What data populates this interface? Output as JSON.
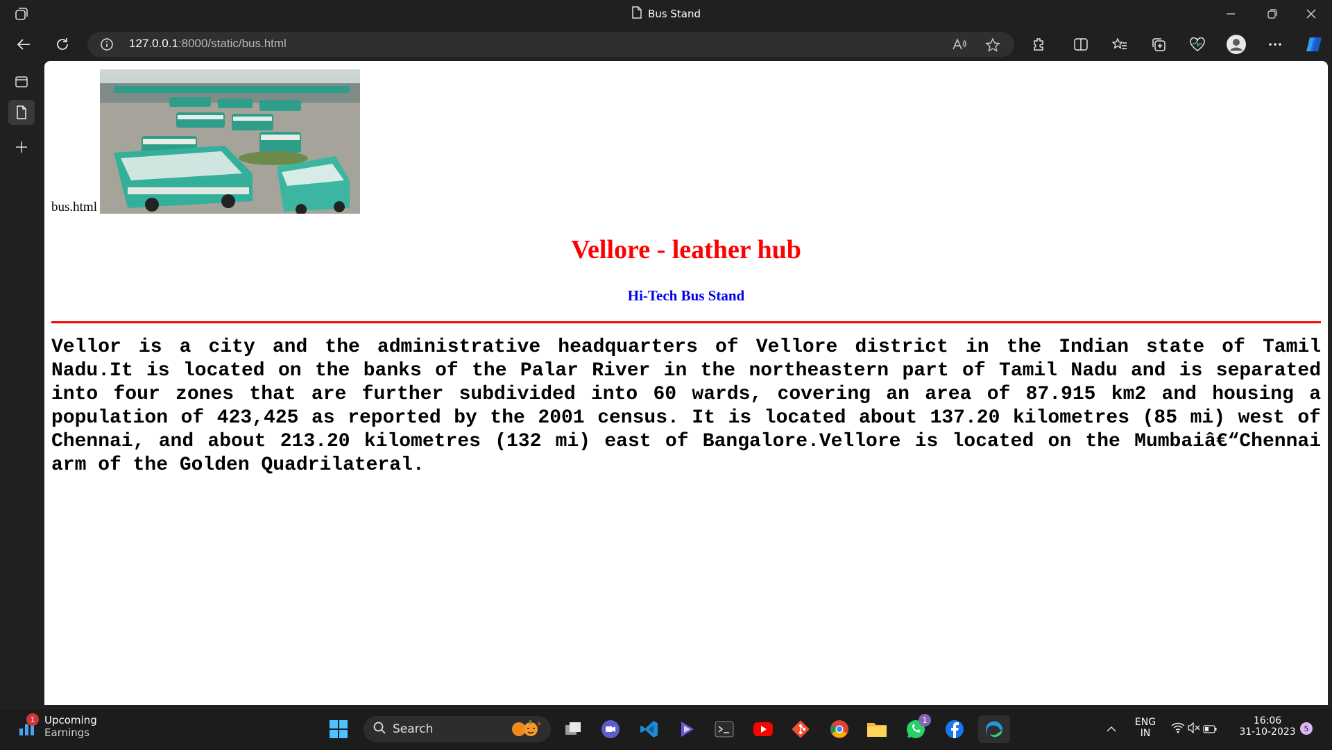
{
  "window": {
    "tab_title": "Bus Stand"
  },
  "address_bar": {
    "url_host": "127.0.0.1",
    "url_path": ":8000/static/bus.html"
  },
  "page": {
    "image_alt": "bus.html",
    "heading": "Vellore - leather hub",
    "subheading": "Hi-Tech Bus Stand",
    "paragraph": "Vellor is a city and the administrative headquarters of Vellore district in the Indian state of Tamil Nadu.It is located on the banks of the Palar River in the northeastern part of Tamil Nadu and is separated into four zones that are further subdivided into 60 wards, covering an area of 87.915 km2 and housing a population of 423,425 as reported by the 2001 census. It is located about 137.20 kilometres (85 mi) west of Chennai, and about 213.20 kilometres (132 mi) east of Bangalore.Vellore is located on the Mumbaiâ€“Chennai arm of the Golden Quadrilateral."
  },
  "taskbar": {
    "widget_title": "Upcoming",
    "widget_subtitle": "Earnings",
    "widget_badge": "1",
    "search_label": "Search",
    "whatsapp_badge": "1",
    "lang_top": "ENG",
    "lang_bottom": "IN",
    "time": "16:06",
    "date": "31-10-2023",
    "notif_count": "5"
  }
}
